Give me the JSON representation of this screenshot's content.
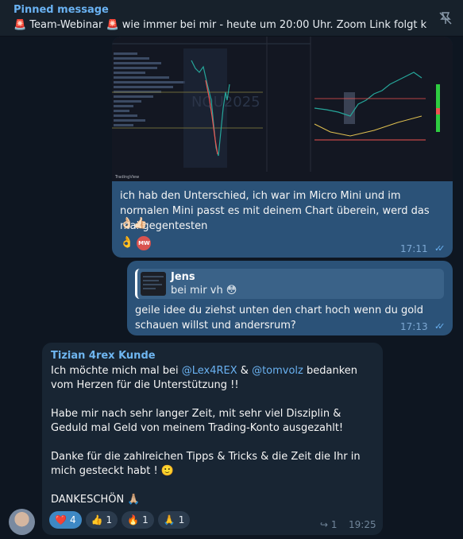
{
  "pinned": {
    "title": "Pinned message",
    "text": "🚨 Team-Webinar 🚨 wie immer bei mir - heute um 20:00 Uhr.  Zoom Link folgt k..."
  },
  "msg1": {
    "image_text": "NQU2025",
    "image_brand": "TradingView",
    "text": "ich hab den Unterschied, ich war im Micro Mini und im normalen Mini passt es mit deinem Chart überein, werd das mal gegentesten",
    "emoji": "👌🏻👍🏻",
    "reaction_emoji": "👌",
    "reaction_badge": "MW",
    "time": "17:11"
  },
  "msg2": {
    "reply_name": "Jens",
    "reply_text": "bei mir vh 😳",
    "text": "geile idee du ziehst unten den chart hoch wenn du gold schauen willst und andersrum?",
    "time": "17:13"
  },
  "msg3": {
    "sender": "Tizian 4rex Kunde",
    "line1_pre": "Ich möchte mich mal bei ",
    "mention1": "@Lex4REX",
    "line1_mid": " & ",
    "mention2": "@tomvolz",
    "line1_post": " bedanken vom Herzen für die Unterstützung !!",
    "para2": "Habe mir nach sehr langer Zeit, mit sehr viel Disziplin & Geduld mal Geld von meinem Trading-Konto ausgezahlt!",
    "para3": "Danke für die zahlreichen Tipps & Tricks & die Zeit die Ihr in mich gesteckt habt ! 🙂",
    "para4": "DANKESCHÖN 🙏🏼",
    "reactions": [
      {
        "emoji": "❤️",
        "count": "4"
      },
      {
        "emoji": "👍",
        "count": "1"
      },
      {
        "emoji": "🔥",
        "count": "1"
      },
      {
        "emoji": "🙏",
        "count": "1"
      }
    ],
    "forward_count": "1",
    "time": "19:25"
  }
}
